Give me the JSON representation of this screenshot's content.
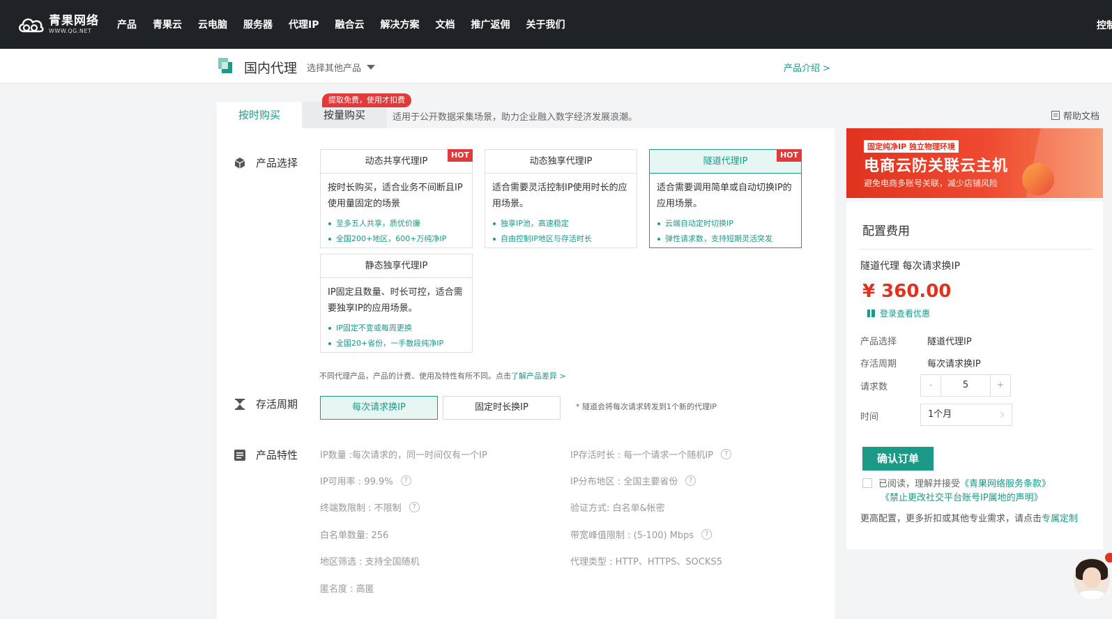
{
  "nav": {
    "logo_cn": "青果网络",
    "logo_en": "WWW.QG.NET",
    "items": [
      "产品",
      "青果云",
      "云电脑",
      "服务器",
      "代理IP",
      "融合云",
      "解决方案",
      "文档",
      "推广返佣",
      "关于我们"
    ],
    "right_label": "控制"
  },
  "product_bar": {
    "title": "国内代理",
    "select_label": "选择其他产品",
    "intro_link": "产品介绍 >"
  },
  "tabs": {
    "items": [
      {
        "label": "按时购买",
        "active": true
      },
      {
        "label": "按量购买",
        "active": false
      }
    ],
    "promo_badge": "提取免费，使用才扣费",
    "description": "适用于公开数据采集场景，助力企业融入数字经济发展浪潮。",
    "help_doc": "帮助文档"
  },
  "sections": {
    "product_select": "产品选择",
    "cycle": "存活周期",
    "features": "产品特性"
  },
  "product_cards": [
    {
      "title": "动态共享代理IP",
      "hot": "HOT",
      "selected": false,
      "desc": "按时长购买，适合业务不间断且IP使用量固定的场景",
      "bullets": [
        "至多五人共享，质优价廉",
        "全国200+地区，600+万纯净IP"
      ]
    },
    {
      "title": "动态独享代理IP",
      "hot": "",
      "selected": false,
      "desc": "适合需要灵活控制IP使用时长的应用场景。",
      "bullets": [
        "独享IP池，高速稳定",
        "自由控制IP地区与存活时长"
      ]
    },
    {
      "title": "隧道代理IP",
      "hot": "HOT",
      "selected": true,
      "desc": "适合需要调用简单或自动切换IP的应用场景。",
      "bullets": [
        "云端自动定时切换IP",
        "弹性请求数，支持短期灵活突发"
      ]
    },
    {
      "title": "静态独享代理IP",
      "hot": "",
      "selected": false,
      "desc": "IP固定且数量、时长可控，适合需要独享IP的应用场景。",
      "bullets": [
        "IP固定不变或每周更换",
        "全国20+省份，一手散段纯净IP"
      ]
    }
  ],
  "diff_note": {
    "text": "不同代理产品，产品的计费、使用及特性有所不同。点击",
    "link": "了解产品差异 >"
  },
  "cycle": {
    "options": [
      {
        "label": "每次请求换IP",
        "active": true
      },
      {
        "label": "固定时长换IP",
        "active": false
      }
    ],
    "note": "* 隧道会将每次请求转发到1个新的代理IP"
  },
  "features": {
    "left": [
      {
        "text": "IP数量 :每次请求的，同一时间仅有一个IP",
        "help": false
      },
      {
        "text": "IP可用率 : 99.9%",
        "help": true
      },
      {
        "text": "终端数限制 : 不限制",
        "help": true
      },
      {
        "text": "白名单数量:  256",
        "help": false
      },
      {
        "text": "地区筛选 : 支持全国随机",
        "help": false
      },
      {
        "text": "匿名度 : 高匿",
        "help": false
      }
    ],
    "right": [
      {
        "text": "IP存活时长 : 每一个请求一个随机IP",
        "help": true
      },
      {
        "text": "IP分布地区 : 全国主要省份",
        "help": true
      },
      {
        "text": "验证方式:  白名单&帐密",
        "help": false
      },
      {
        "text": "带宽峰值限制 :  (5-100) Mbps",
        "help": true
      },
      {
        "text": "代理类型 : HTTP、HTTPS、SOCKS5",
        "help": false
      }
    ],
    "help_glyph": "?"
  },
  "banner": {
    "tag": "固定纯净IP 独立物理环境",
    "title": "电商云防关联云主机",
    "subtitle": "避免电商多账号关联，减少店铺风险"
  },
  "order": {
    "title": "配置费用",
    "summary": "隧道代理  每次请求换IP",
    "price": "¥ 360.00",
    "discount_link": "登录查看优惠",
    "rows": [
      {
        "key": "产品选择",
        "value": "隧道代理IP"
      },
      {
        "key": "存活周期",
        "value": "每次请求换IP"
      },
      {
        "key": "请求数",
        "value": ""
      },
      {
        "key": "时间",
        "value": ""
      }
    ],
    "stepper": {
      "minus": "-",
      "value": "5",
      "plus": "+"
    },
    "time_value": "1个月",
    "confirm_label": "确认订单",
    "agree_prefix": "已阅读，理解并接受",
    "agree_link1": "《青果网络服务条款》",
    "agree_link2": "《禁止更改社交平台账号IP属地的声明》",
    "more_text": "更高配置，更多折扣或其他专业需求，请点击",
    "more_link": "专属定制"
  },
  "colors": {
    "accent": "#1a9a87",
    "price": "#e0331f",
    "hot": "#e03a3a",
    "nav_bg": "#1f2226"
  }
}
